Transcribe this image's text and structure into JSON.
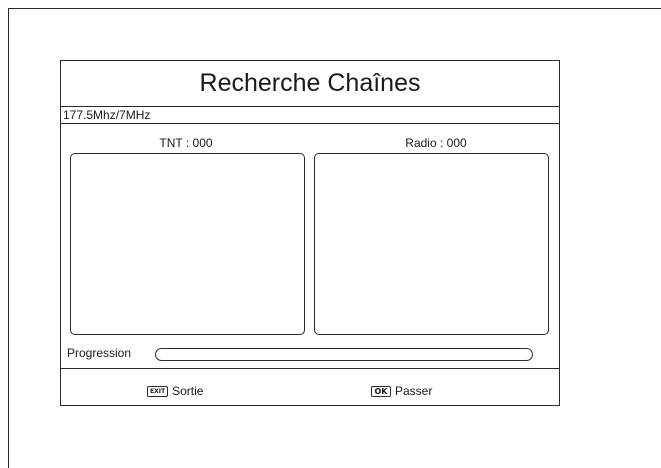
{
  "dialog": {
    "title": "Recherche Chaînes",
    "frequency": "177.5Mhz/7MHz",
    "tnt_label": "TNT : 000",
    "radio_label": "Radio : 000",
    "progress_label": "Progression",
    "progress_value": 0
  },
  "footer": {
    "exit_key": "EXIT",
    "exit_label": "Sortie",
    "ok_key": "OK",
    "ok_label": "Passer"
  }
}
